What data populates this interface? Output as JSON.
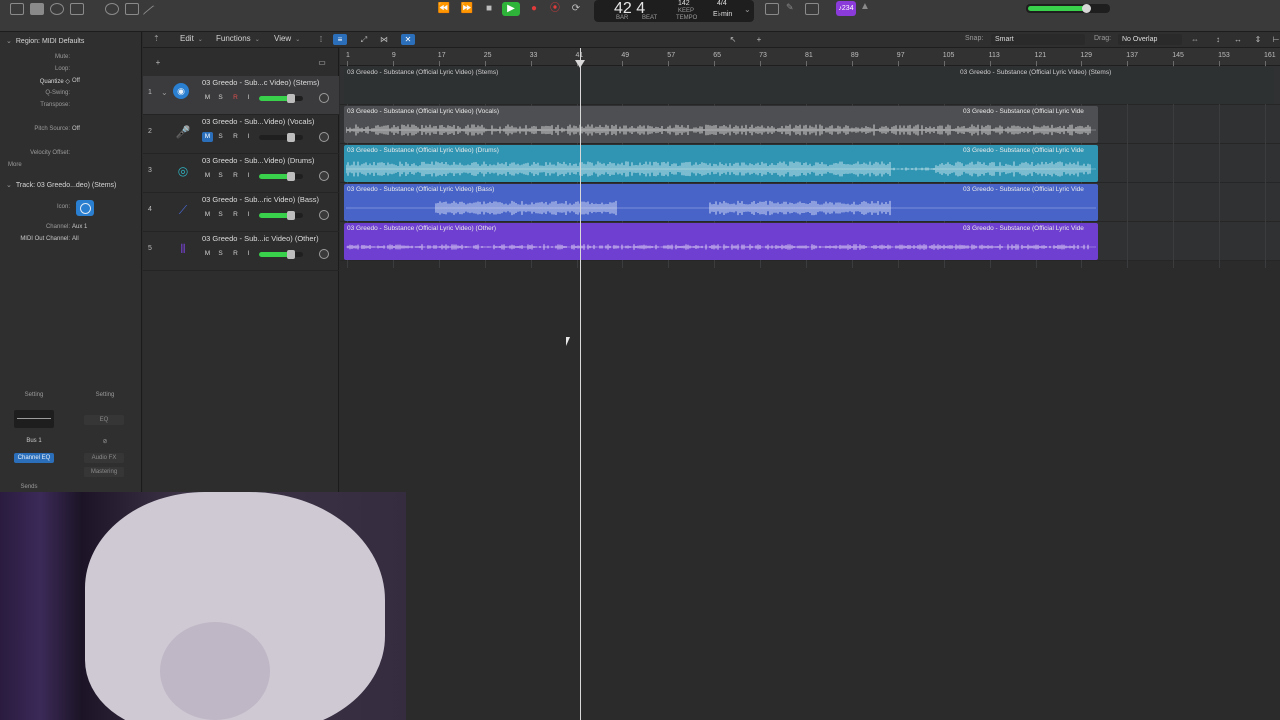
{
  "control_bar": {
    "lcd": {
      "position": "42 4",
      "bar_label": "BAR",
      "beat_label": "BEAT",
      "tempo_value": "142",
      "tempo_mode": "KEEP",
      "tempo_label": "TEMPO",
      "time_sig": "4/4",
      "key": "E♭min"
    },
    "badge": "♪234",
    "transport": [
      "⏪",
      "⏩",
      "■",
      "▶",
      "●",
      "⦿",
      "⟳"
    ]
  },
  "inspector": {
    "region_header": "Region: MIDI Defaults",
    "region_rows": [
      {
        "label": "Mute:",
        "value": ""
      },
      {
        "label": "Loop:",
        "value": ""
      },
      {
        "label": "Quantize ◇",
        "value": "Off"
      },
      {
        "label": "Q-Swing:",
        "value": ""
      },
      {
        "label": "Transpose:",
        "value": ""
      },
      {
        "label": "Pitch Source:",
        "value": "Off"
      },
      {
        "label": "Velocity Offset:",
        "value": ""
      },
      {
        "label": "More",
        "value": ""
      }
    ],
    "track_header": "Track: 03 Greedo...deo) (Stems)",
    "track_rows": [
      {
        "label": "Icon:",
        "value": ""
      },
      {
        "label": "Channel:",
        "value": "Aux 1"
      },
      {
        "label": "MIDI Out Channel:",
        "value": "All"
      }
    ],
    "strip": {
      "setting_left": "Setting",
      "setting_right": "Setting",
      "eq_right": "EQ",
      "bus": "Bus 1",
      "channel_eq": "Channel EQ",
      "audio_fx": "Audio FX",
      "mastering": "Mastering",
      "sends": "Sends"
    }
  },
  "toolbar": {
    "edit": "Edit",
    "functions": "Functions",
    "view": "View",
    "snap_label": "Snap:",
    "snap_value": "Smart",
    "drag_label": "Drag:",
    "drag_value": "No Overlap"
  },
  "tracks": [
    {
      "num": "1",
      "name": "03 Greedo - Sub...c Video) (Stems)",
      "mute": "M",
      "solo": "S",
      "rec": "R",
      "input": "I",
      "volume": 0.72,
      "icon": "folder-stack-icon",
      "color": "#2a7fd0",
      "selected": true
    },
    {
      "num": "2",
      "name": "03 Greedo - Sub...Video) (Vocals)",
      "mute": "M",
      "solo": "S",
      "rec": "R",
      "input": "I",
      "volume": 0.72,
      "icon": "microphone-icon",
      "color": "#2fb6c4"
    },
    {
      "num": "3",
      "name": "03 Greedo - Sub...Video) (Drums)",
      "mute": "M",
      "solo": "S",
      "rec": "R",
      "input": "I",
      "volume": 0.72,
      "icon": "drum-kit-icon",
      "color": "#2fb6c4"
    },
    {
      "num": "4",
      "name": "03 Greedo - Sub...ric Video) (Bass)",
      "mute": "M",
      "solo": "S",
      "rec": "R",
      "input": "I",
      "volume": 0.72,
      "icon": "bass-guitar-icon",
      "color": "#4a6cd6"
    },
    {
      "num": "5",
      "name": "03 Greedo - Sub...ic Video) (Other)",
      "mute": "M",
      "solo": "S",
      "rec": "R",
      "input": "I",
      "volume": 0.72,
      "icon": "waveform-icon",
      "color": "#7a43d6"
    }
  ],
  "ruler": [
    "1",
    "9",
    "17",
    "25",
    "33",
    "41",
    "49",
    "57",
    "65",
    "73",
    "81",
    "89",
    "97",
    "105",
    "113",
    "121",
    "129",
    "137",
    "145",
    "153",
    "161"
  ],
  "regions": [
    {
      "name": "folder",
      "label_left": "03 Greedo - Substance (Official Lyric Video) (Stems)",
      "label_right": "03 Greedo - Substance (Official Lyric Video) (Stems)",
      "color": "#2e3132"
    },
    {
      "name": "vocals",
      "label_left": "03 Greedo - Substance (Official Lyric Video) (Vocals)",
      "label_right": "03 Greedo - Substance (Official Lyric Vide",
      "color": "#4e4f52"
    },
    {
      "name": "drums",
      "label_left": "03 Greedo - Substance (Official Lyric Video) (Drums)",
      "label_right": "03 Greedo - Substance (Official Lyric Vide",
      "color": "#2f95b3"
    },
    {
      "name": "bass",
      "label_left": "03 Greedo - Substance (Official Lyric Video) (Bass)",
      "label_right": "03 Greedo - Substance (Official Lyric Vide",
      "color": "#4864c9"
    },
    {
      "name": "other",
      "label_left": "03 Greedo - Substance (Official Lyric Video) (Other)",
      "label_right": "03 Greedo - Substance (Official Lyric Vide",
      "color": "#6e3fd0"
    }
  ],
  "playhead_bar": "41"
}
